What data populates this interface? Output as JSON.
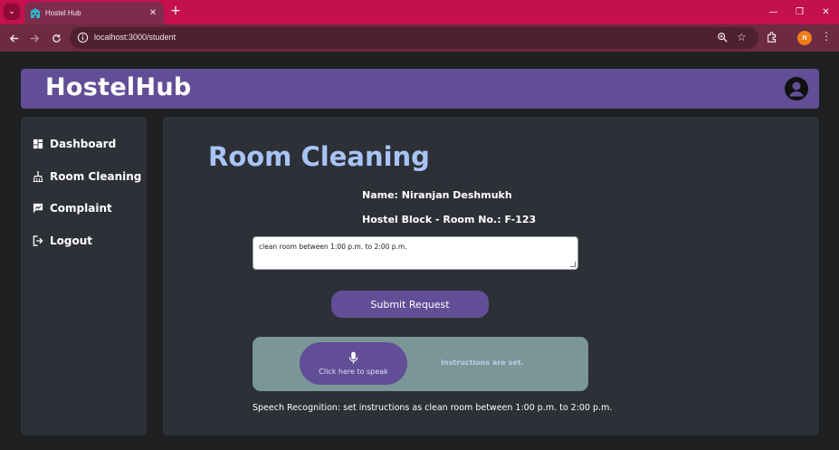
{
  "browser": {
    "tab_title": "Hostel Hub",
    "tab_close": "✕",
    "new_tab": "+",
    "url": "localhost:3000/student",
    "profile_initial": "N",
    "menu": "⋮",
    "star": "☆",
    "window_controls": {
      "minimize": "—",
      "restore": "❐",
      "close": "✕"
    },
    "theme_color": "#c4104f"
  },
  "header": {
    "brand": "HostelHub",
    "accent": "#614e96"
  },
  "sidebar": {
    "items": [
      {
        "label": "Dashboard",
        "icon": "dashboard-icon"
      },
      {
        "label": "Room Cleaning",
        "icon": "broom-icon"
      },
      {
        "label": "Complaint",
        "icon": "complaint-icon"
      },
      {
        "label": "Logout",
        "icon": "logout-icon"
      }
    ]
  },
  "main": {
    "title": "Room Cleaning",
    "name_line": "Name: Niranjan Deshmukh",
    "room_line": "Hostel Block - Room No.: F-123",
    "instructions_value": "clean room between 1:00 p.m. to 2:00 p.m.",
    "submit_label": "Submit Request",
    "speak_label": "Click here to speak",
    "status_text": "Instructions are set.",
    "speech_result": "Speech Recognition: set instructions as clean room between 1:00 p.m. to 2:00 p.m."
  }
}
